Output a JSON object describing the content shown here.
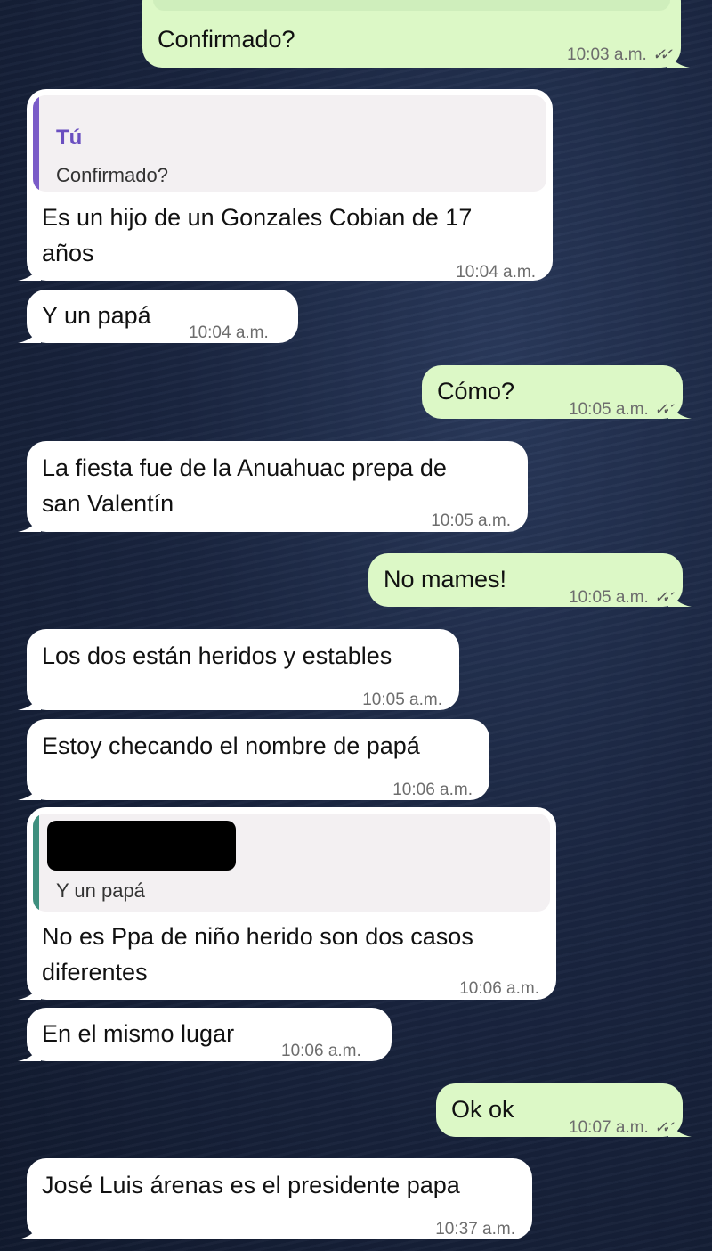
{
  "colors": {
    "incoming_bubble": "#ffffff",
    "outgoing_bubble": "#dcf8c6",
    "quote_self_bar": "#7a5cc8",
    "quote_other_bar": "#3e8f7e"
  },
  "messages": [
    {
      "dir": "out",
      "text": "Confirmado?",
      "time": "10:03 a.m."
    },
    {
      "dir": "in",
      "quote_author": "Tú",
      "quote_text": "Confirmado?",
      "text_line1": "Es un hijo  de un Gonzales Cobian de 17",
      "text_line2": "años",
      "time": "10:04 a.m."
    },
    {
      "dir": "in",
      "text": "Y un papá",
      "time": "10:04 a.m."
    },
    {
      "dir": "out",
      "text": "Cómo?",
      "time": "10:05 a.m."
    },
    {
      "dir": "in",
      "text_line1": "La fiesta fue de la Anuahuac prepa de",
      "text_line2": "san Valentín",
      "time": "10:05 a.m."
    },
    {
      "dir": "out",
      "text": "No mames!",
      "time": "10:05 a.m."
    },
    {
      "dir": "in",
      "text": "Los dos están heridos y estables",
      "time": "10:05 a.m."
    },
    {
      "dir": "in",
      "text": "Estoy checando el nombre de papá",
      "time": "10:06 a.m."
    },
    {
      "dir": "in",
      "quote_text": "Y un papá",
      "text_line1": "No es Ppa de niño herido son dos casos",
      "text_line2": "diferentes",
      "time": "10:06 a.m."
    },
    {
      "dir": "in",
      "text": "En el mismo lugar",
      "time": "10:06 a.m."
    },
    {
      "dir": "out",
      "text": "Ok ok",
      "time": "10:07 a.m."
    },
    {
      "dir": "in",
      "text": "José Luis árenas es el presidente papa",
      "time": "10:37 a.m."
    }
  ]
}
